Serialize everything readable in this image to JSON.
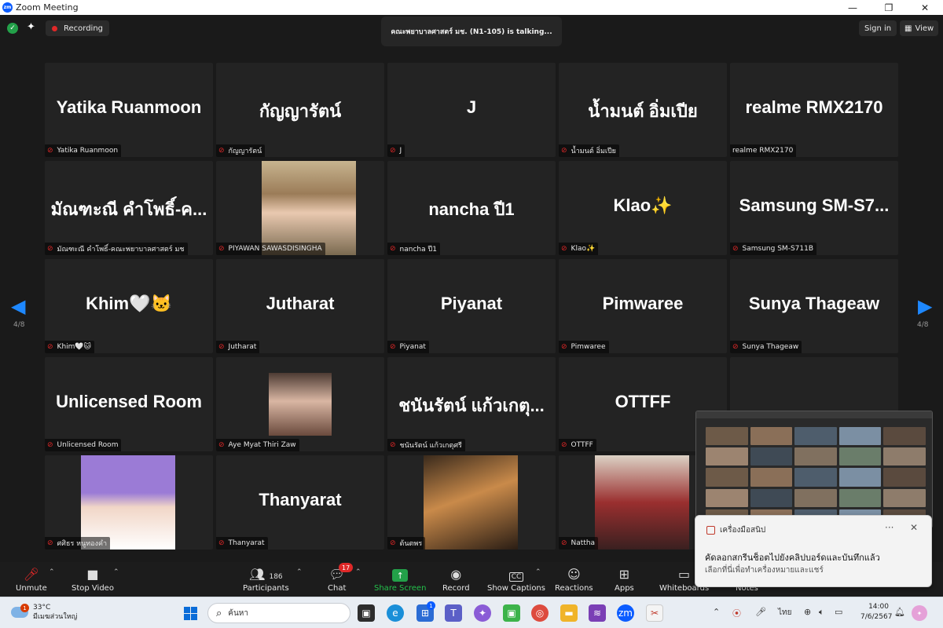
{
  "window": {
    "title": "Zoom Meeting",
    "logo": "zm",
    "controls": [
      "—",
      "❐",
      "✕"
    ]
  },
  "top": {
    "recording_label": "Recording",
    "talking": "คณะพยาบาลศาสตร์ มช. (N1-105) is talking...",
    "sign_in": "Sign in",
    "view": "View"
  },
  "pager": {
    "left_count": "4/8",
    "right_count": "4/8"
  },
  "tiles": [
    {
      "big": "Yatika Ruanmoon",
      "name": "Yatika Ruanmoon",
      "muted": true
    },
    {
      "big": "กัญญารัตน์",
      "name": "กัญญารัตน์",
      "muted": true
    },
    {
      "big": "J",
      "name": "J",
      "muted": true
    },
    {
      "big": "น้ำมนต์ อิ่มเปีย",
      "name": "น้ำมนต์ อิ่มเปีย",
      "muted": true
    },
    {
      "big": "realme RMX2170",
      "name": "realme RMX2170",
      "muted": false
    },
    {
      "big": "มัณฑะณี คำโพธิ์-ค...",
      "name": "มัณฑะณี คำโพธิ์-คณะพยาบาลศาสตร์ มช",
      "muted": true
    },
    {
      "big": "",
      "name": "PIYAWAN SAWASDISINGHA",
      "muted": true,
      "photo": "woman-glasses"
    },
    {
      "big": "nancha ปี1",
      "name": "nancha ปี1",
      "muted": true
    },
    {
      "big": "Klao✨",
      "name": "Klao✨",
      "muted": true
    },
    {
      "big": "Samsung SM-S7...",
      "name": "Samsung SM-S711B",
      "muted": true
    },
    {
      "big": "Khim🤍🐱",
      "name": "Khim🤍🐱",
      "muted": true
    },
    {
      "big": "Jutharat",
      "name": "Jutharat",
      "muted": true
    },
    {
      "big": "Piyanat",
      "name": "Piyanat",
      "muted": true
    },
    {
      "big": "Pimwaree",
      "name": "Pimwaree",
      "muted": true
    },
    {
      "big": "Sunya Thageaw",
      "name": "Sunya Thageaw",
      "muted": true
    },
    {
      "big": "Unlicensed Room",
      "name": "Unlicensed Room",
      "muted": true
    },
    {
      "big": "",
      "name": "Aye Myat Thiri Zaw",
      "muted": true,
      "photo": "woman-hair"
    },
    {
      "big": "ชนันรัตน์ แก้วเกตุ...",
      "name": "ชนันรัตน์ แก้วเกตุศรี",
      "muted": true
    },
    {
      "big": "OTTFF",
      "name": "OTTFF",
      "muted": true
    },
    {
      "big": "",
      "name": "",
      "muted": false
    },
    {
      "big": "",
      "name": "ศศิธร หนูทองคำ",
      "muted": true,
      "photo": "woman-purple"
    },
    {
      "big": "Thanyarat",
      "name": "Thanyarat",
      "muted": true
    },
    {
      "big": "",
      "name": "ต้นตพร",
      "muted": true,
      "photo": "woman-sunlight"
    },
    {
      "big": "",
      "name": "Nattha",
      "muted": true,
      "photo": "woman-wine"
    },
    {
      "big": "",
      "name": "",
      "muted": false
    }
  ],
  "toolbar": {
    "unmute": "Unmute",
    "stop_video": "Stop Video",
    "participants": "Participants",
    "participants_count": "186",
    "chat": "Chat",
    "chat_badge": "17",
    "share_screen": "Share Screen",
    "record": "Record",
    "show_captions": "Show Captions",
    "reactions": "Reactions",
    "apps": "Apps",
    "whiteboards": "Whiteboards",
    "notes": "Notes"
  },
  "snip_popup": {
    "app_name": "เครื่องมือสนิป",
    "title": "คัดลอกสกรีนช็อตไปยังคลิปบอร์ดและบันทึกแล้ว",
    "body": "เลือกที่นี่เพื่อทำเครื่องหมายและแชร์"
  },
  "taskbar": {
    "temp": "33°C",
    "weather_text": "มีเมฆส่วนใหญ่",
    "weather_badge": "1",
    "search_placeholder": "ค้นหา",
    "store_badge": "1",
    "lang": "ไทย",
    "time": "14:00",
    "date": "7/6/2567"
  },
  "colors": {
    "accent_blue": "#1e88ff",
    "share_green": "#23c24b",
    "muted_red": "#e02828"
  }
}
